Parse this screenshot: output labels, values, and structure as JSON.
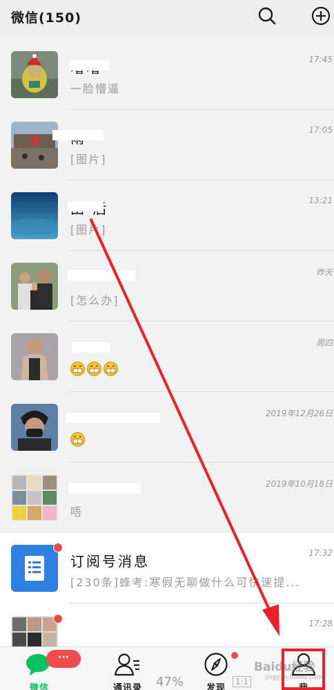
{
  "header": {
    "title": "微信(150)",
    "search_icon": "search-icon",
    "add_icon": "plus-circle-icon"
  },
  "chats": [
    {
      "name": "  噜噜",
      "time": "17:45",
      "preview": "一脸懵逼",
      "avatar": "teletubby-avatar"
    },
    {
      "name": " 雨",
      "time": "17:05",
      "preview": "[图片]",
      "avatar": "landmark-avatar"
    },
    {
      "name": "田 后",
      "time": "13:21",
      "preview": "[图片]",
      "avatar": "sky-avatar"
    },
    {
      "name": "",
      "time": "昨天",
      "preview": "[怎么办]",
      "avatar": "family-avatar"
    },
    {
      "name": "",
      "time": "周四",
      "preview": "",
      "emoji_count": 3,
      "avatar": "person-avatar"
    },
    {
      "name": "",
      "time": "2019年12月26日",
      "preview": "",
      "emoji_count": 1,
      "avatar": "masked-person-avatar"
    },
    {
      "name": "",
      "time": "2019年10月18日",
      "preview": "唔",
      "avatar": "group-avatar"
    },
    {
      "name": "订阅号消息",
      "time": "17:32",
      "preview": "[230条]蜂考:寒假无聊做什么可快速提...",
      "avatar": "subscription-avatar",
      "dot": true
    },
    {
      "name": "",
      "time": "17:28",
      "preview": "",
      "avatar": "group-photo-avatar",
      "dot": true
    }
  ],
  "tabs": [
    {
      "label": "微信",
      "icon": "chat-bubble-icon",
      "badge": "···"
    },
    {
      "label": "通讯录",
      "icon": "contacts-icon"
    },
    {
      "label": "发现",
      "icon": "compass-icon",
      "dot": true
    },
    {
      "label": "我",
      "icon": "person-icon"
    }
  ],
  "overlay": {
    "zoom": "47%",
    "fit": "1:1"
  },
  "watermark": {
    "text": "Baidu经验",
    "sub": "jingyan.baidu.com"
  },
  "colors": {
    "accent": "#07c160",
    "badge": "#f04a4a",
    "annotation": "#e8212a"
  }
}
